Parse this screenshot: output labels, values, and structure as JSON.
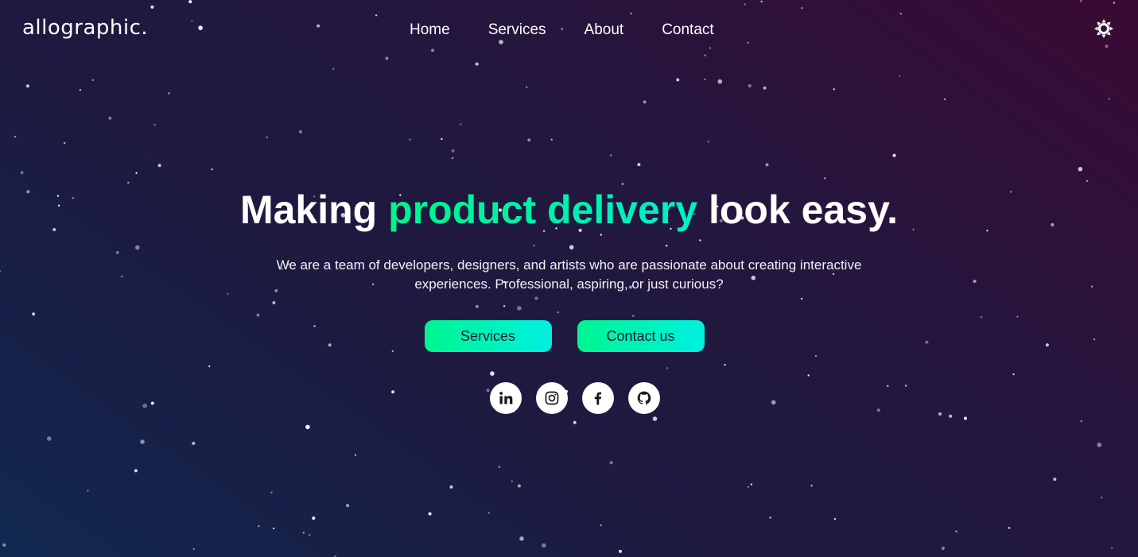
{
  "header": {
    "logo": "allographic.",
    "nav": [
      {
        "label": "Home"
      },
      {
        "label": "Services"
      },
      {
        "label": "About"
      },
      {
        "label": "Contact"
      }
    ],
    "theme_toggle_icon": "sun-icon"
  },
  "hero": {
    "headline_pre": "Making ",
    "headline_accent": "product delivery",
    "headline_post": " look easy.",
    "subtitle": "We are a team of developers, designers, and artists who are passionate about creating interactive experiences. Professional, aspiring, or just curious?",
    "buttons": {
      "services": "Services",
      "contact": "Contact us"
    },
    "socials": [
      "linkedin-icon",
      "instagram-icon",
      "facebook-icon",
      "github-icon"
    ]
  },
  "colors": {
    "accent_start": "#00f58a",
    "accent_end": "#00efcc",
    "background_dark": "#1d1a40"
  }
}
